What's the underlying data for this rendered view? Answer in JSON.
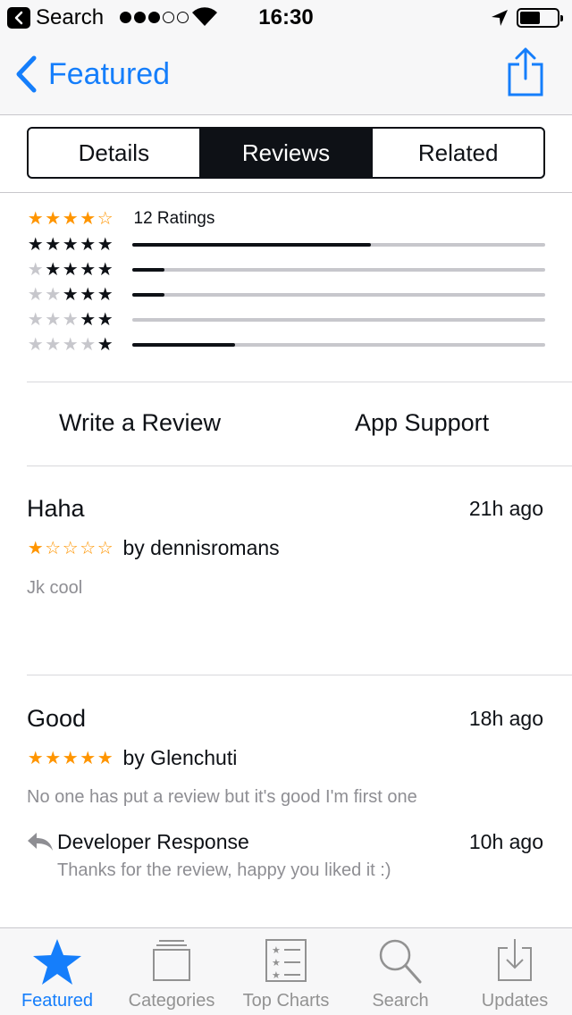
{
  "status_bar": {
    "carrier": "Search",
    "time": "16:30",
    "signal_filled": 3,
    "signal_total": 5
  },
  "nav": {
    "back_label": "Featured",
    "accent_color": "#157efb"
  },
  "segments": [
    {
      "label": "Details",
      "active": false
    },
    {
      "label": "Reviews",
      "active": true
    },
    {
      "label": "Related",
      "active": false
    }
  ],
  "ratings": {
    "average_stars": 4,
    "summary_label": "12 Ratings",
    "distribution": [
      {
        "stars": 5,
        "fraction": 0.58
      },
      {
        "stars": 4,
        "fraction": 0.08
      },
      {
        "stars": 3,
        "fraction": 0.08
      },
      {
        "stars": 2,
        "fraction": 0.0
      },
      {
        "stars": 1,
        "fraction": 0.25
      }
    ]
  },
  "actions": {
    "write_review": "Write a Review",
    "app_support": "App Support"
  },
  "reviews": [
    {
      "title": "Haha",
      "time": "21h ago",
      "stars": 1,
      "author": "by dennisromans",
      "body": "Jk cool"
    },
    {
      "title": "Good",
      "time": "18h ago",
      "stars": 5,
      "author": "by Glenchuti",
      "body": "No one has put a review but it's good I'm first one",
      "developer_response": {
        "title": "Developer Response",
        "time": "10h ago",
        "body": "Thanks for the review, happy you liked it :)"
      }
    }
  ],
  "tab_bar": {
    "tabs": [
      {
        "label": "Featured",
        "icon": "star-icon",
        "active": true
      },
      {
        "label": "Categories",
        "icon": "categories-icon",
        "active": false
      },
      {
        "label": "Top Charts",
        "icon": "top-charts-icon",
        "active": false
      },
      {
        "label": "Search",
        "icon": "search-icon",
        "active": false
      },
      {
        "label": "Updates",
        "icon": "updates-icon",
        "active": false
      }
    ]
  }
}
